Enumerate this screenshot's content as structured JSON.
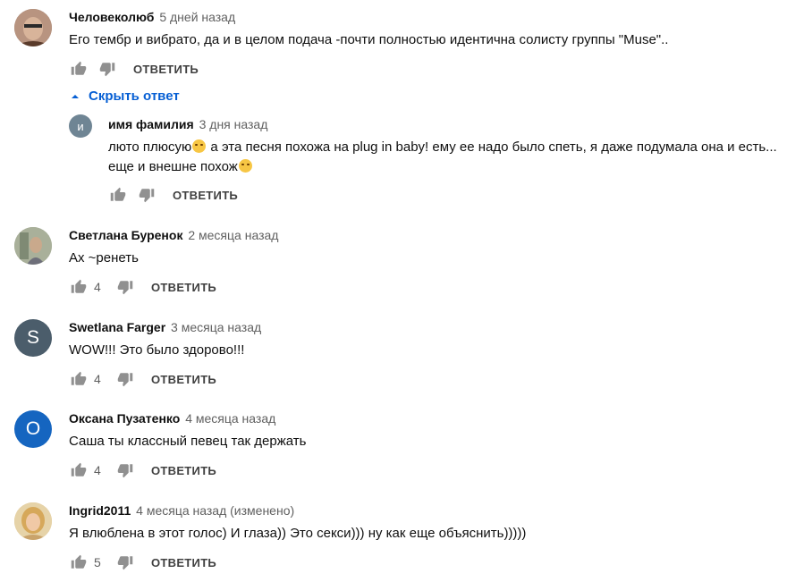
{
  "comments": [
    {
      "author": "Человеколюб",
      "time": "5 дней назад",
      "text": "Его тембр и вибрато,  да и в целом подача -почти полностью идентична солисту группы \"Muse\"..",
      "likes": "",
      "avatar_letter": "",
      "avatar_color": "#8a6d5a"
    },
    {
      "author": "Светлана Буренок",
      "time": "2 месяца назад",
      "text": "Ах ~ренеть",
      "likes": "4",
      "avatar_letter": "",
      "avatar_color": "#9aa38a"
    },
    {
      "author": "Swetlana Farger",
      "time": "3 месяца назад",
      "text": "WOW!!!  Это было здорово!!!",
      "likes": "4",
      "avatar_letter": "S",
      "avatar_color": "#4b5d6b"
    },
    {
      "author": "Оксана Пузатенко",
      "time": "4 месяца назад",
      "text": "Саша ты классный певец так держать",
      "likes": "4",
      "avatar_letter": "О",
      "avatar_color": "#1565c0"
    },
    {
      "author": "Ingrid2011",
      "time": "4 месяца назад (изменено)",
      "text": "Я влюблена в этот голос) И глаза)) Это секси))) ну как еще объяснить)))))",
      "likes": "5",
      "avatar_letter": "",
      "avatar_color": "#d9b877"
    }
  ],
  "hide_replies_label": "Скрыть ответ",
  "reply": {
    "author": "имя фамилия",
    "time": "3 дня назад",
    "text_line1_a": "люто плюсую",
    "text_line1_b": " а эта песня похожа на plug in baby! ему ее надо было спеть, я даже подумала она и есть...",
    "text_line2": "еще и внешне похож",
    "avatar_letter": "и",
    "avatar_color": "#6f8594"
  },
  "reply_label": "ОТВЕТИТЬ",
  "colors": {
    "link": "#065fd4",
    "meta": "#606060"
  }
}
